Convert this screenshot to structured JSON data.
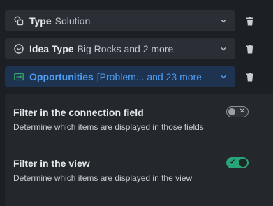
{
  "filters": [
    {
      "label": "Type",
      "value": "Solution",
      "icon": "shapes-icon",
      "active": false
    },
    {
      "label": "Idea Type",
      "value": "Big Rocks and 2 more",
      "icon": "circle-chevron-icon",
      "active": false
    },
    {
      "label": "Opportunities",
      "value": "[Problem... and 23 more",
      "icon": "link-field-icon",
      "active": true
    }
  ],
  "settings": {
    "connection": {
      "title": "Filter in the connection field",
      "desc": "Determine which items are displayed in those fields",
      "enabled": false,
      "mark": "✕"
    },
    "view": {
      "title": "Filter in the view",
      "desc": "Determine which items are displayed in the view",
      "enabled": true,
      "mark": "✓"
    }
  },
  "colors": {
    "active_accent": "#4f9cf0",
    "toggle_on": "#2aa37a"
  }
}
